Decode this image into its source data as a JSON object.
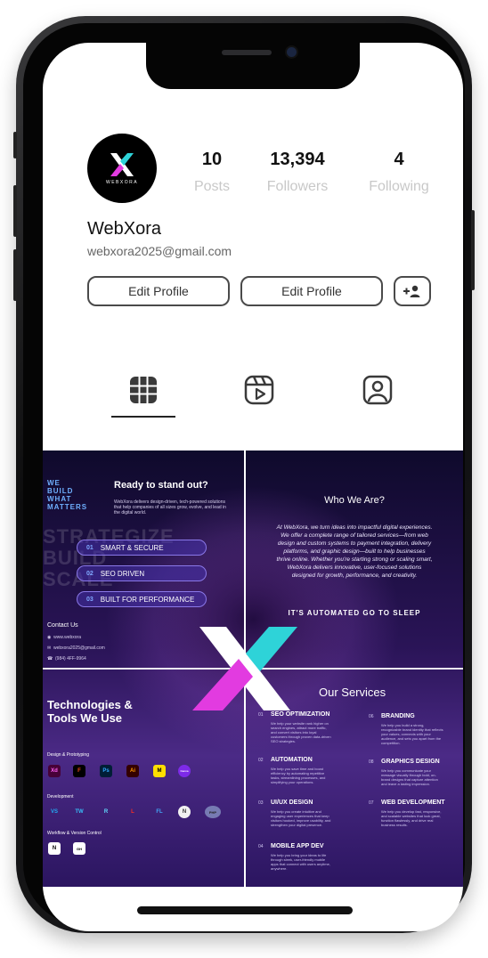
{
  "profile": {
    "brand_mark_text": "WEBXORA",
    "name": "WebXora",
    "email": "webxora2025@gmail.com"
  },
  "stats": [
    {
      "value": "10",
      "label": "Posts"
    },
    {
      "value": "13,394",
      "label": "Followers"
    },
    {
      "value": "4",
      "label": "Following"
    }
  ],
  "actions": {
    "edit_profile_1": "Edit Profile",
    "edit_profile_2": "Edit Profile"
  },
  "tabs": [
    "grid-icon",
    "reels-icon",
    "tagged-icon"
  ],
  "posts": {
    "tl": {
      "we_build": [
        "WE",
        "BUILD",
        "WHAT",
        "MATTERS"
      ],
      "heading": "Ready to stand out?",
      "sub": "WebXora delivers design-driven, tech-powered solutions that help companies of all sizes grow, evolve, and lead in the digital world.",
      "ghost": [
        "STRATEGIZE",
        "BUILD",
        "SCALE"
      ],
      "pills": [
        {
          "n": "01",
          "label": "SMART & SECURE"
        },
        {
          "n": "02",
          "label": "SEO DRIVEN"
        },
        {
          "n": "03",
          "label": "BUILT FOR PERFORMANCE"
        }
      ],
      "contact_title": "Contact Us",
      "contact": [
        "www.webxora",
        "webxora2025@gmail.com",
        "(984) 4FF-9964"
      ]
    },
    "tr": {
      "heading": "Who We Are?",
      "body": "At WebXora, we turn ideas into impactful digital experiences. We offer a complete range of tailored services—from web design and custom systems to payment integration, delivery platforms, and graphic design—built to help businesses thrive online. Whether you're starting strong or scaling smart, WebXora delivers innovative, user-focused solutions designed for growth, performance, and creativity.",
      "tagline": "IT'S AUTOMATED GO TO SLEEP"
    },
    "bl": {
      "heading_1": "Technologies &",
      "heading_2": "Tools We Use",
      "design_title": "Design & Prototyping",
      "design_tools": [
        "Xd",
        "F",
        "Ps",
        "Ai",
        "M",
        "Canva"
      ],
      "dev_title": "Development",
      "dev_tools": [
        "VS",
        "TW",
        "R",
        "L",
        "FL",
        "N",
        "PHP"
      ],
      "workflow_title": "Workflow & Version Control",
      "workflow_tools": [
        "N",
        "GH"
      ]
    },
    "br": {
      "heading": "Our Services",
      "services": [
        {
          "n": "01",
          "title": "SEO OPTIMIZATION",
          "desc": "We help your website rank higher on search engines, attract more traffic, and convert visitors into loyal customers through proven data-driven SEO strategies."
        },
        {
          "n": "06",
          "title": "BRANDING",
          "desc": "We help you build a strong, recognizable brand identity that reflects your values, connects with your audience, and sets you apart from the competition."
        },
        {
          "n": "02",
          "title": "AUTOMATION",
          "desc": "We help you save time and boost efficiency by automating repetitive tasks, streamlining processes, and simplifying your operations."
        },
        {
          "n": "08",
          "title": "GRAPHICS DESIGN",
          "desc": "We help you communicate your message visually through bold, on-brand designs that capture attention and leave a lasting impression."
        },
        {
          "n": "03",
          "title": "UI/UX DESIGN",
          "desc": "We help you create intuitive and engaging user experiences that keep visitors hooked, improve usability, and strengthen your digital presence."
        },
        {
          "n": "07",
          "title": "WEB DEVELOPMENT",
          "desc": "We help you develop fast, responsive, and scalable websites that look great, function flawlessly, and drive real business results."
        },
        {
          "n": "04",
          "title": "MOBILE APP DEV",
          "desc": "We help you bring your ideas to life through sleek, user-friendly mobile apps that connect with users anytime, anywhere."
        }
      ]
    }
  },
  "colors": {
    "accent_cyan": "#2ed3d8",
    "accent_magenta": "#e23be0",
    "text_dark": "#111111",
    "stat_label": "#c8c8c8"
  }
}
